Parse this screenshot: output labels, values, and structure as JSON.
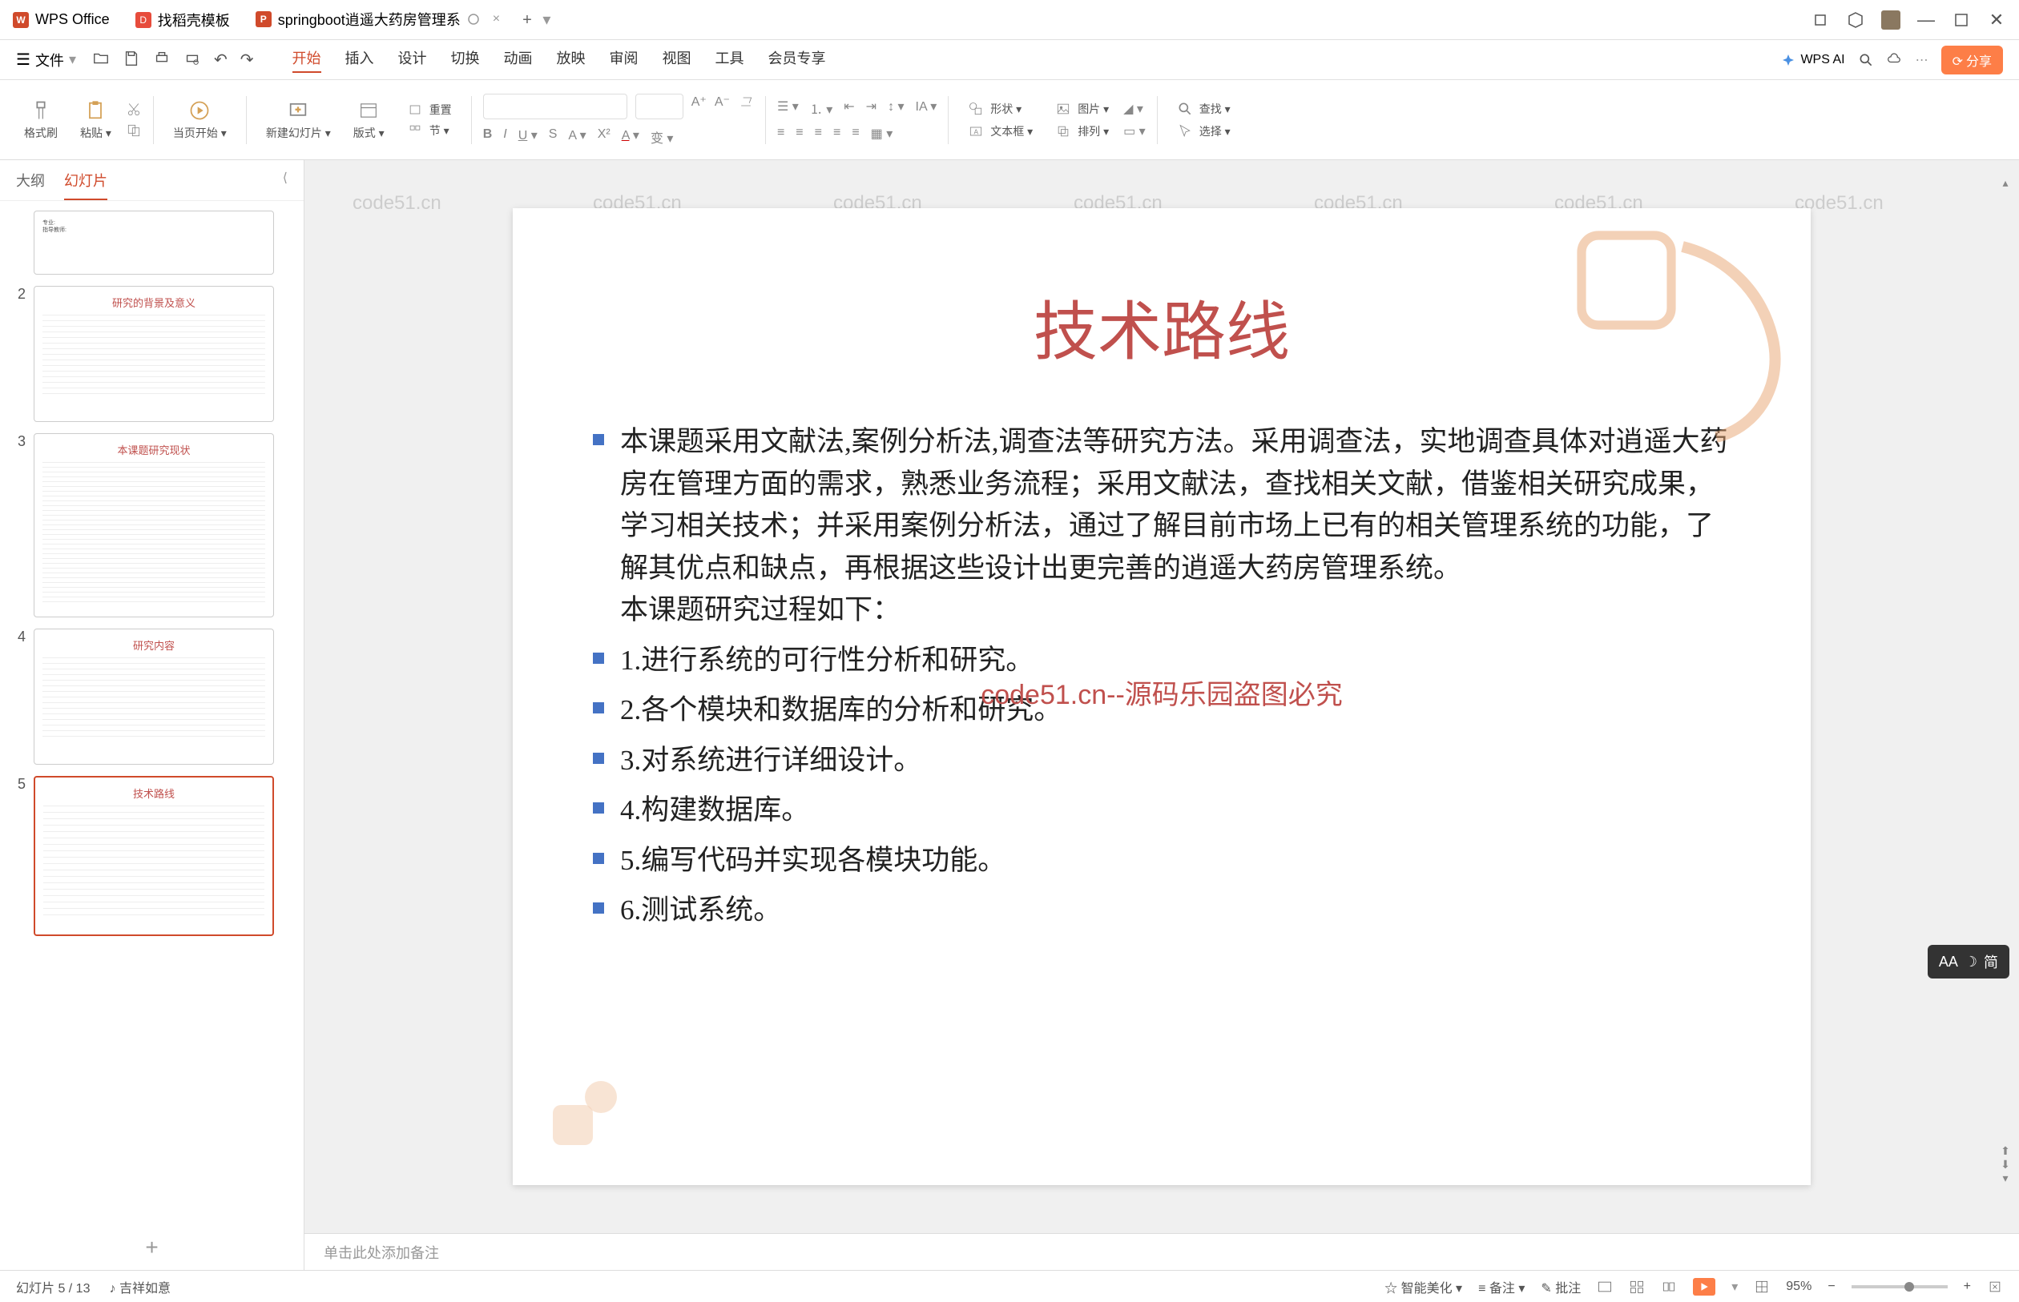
{
  "titlebar": {
    "wps_office": "WPS Office",
    "doke": "找稻壳模板",
    "active_tab": "springboot逍遥大药房管理系",
    "add": "+"
  },
  "menubar": {
    "file": "文件",
    "tabs": {
      "start": "开始",
      "insert": "插入",
      "design": "设计",
      "transition": "切换",
      "animation": "动画",
      "slideshow": "放映",
      "review": "审阅",
      "view": "视图",
      "tools": "工具",
      "member": "会员专享"
    },
    "wps_ai": "WPS AI",
    "share": "分享"
  },
  "toolbar": {
    "format_brush": "格式刷",
    "paste": "粘贴",
    "from_current": "当页开始",
    "new_slide": "新建幻灯片",
    "layout": "版式",
    "section": "节",
    "reset": "重置",
    "shape": "形状",
    "picture": "图片",
    "textbox": "文本框",
    "arrange": "排列",
    "find": "查找",
    "select": "选择"
  },
  "sidebar": {
    "outline": "大纲",
    "slides": "幻灯片",
    "thumbs": [
      {
        "num": "",
        "title": "",
        "lines": [
          "专业:",
          "指导教师:"
        ]
      },
      {
        "num": "2",
        "title": "研究的背景及意义",
        "lines": [
          ""
        ]
      },
      {
        "num": "3",
        "title": "本课题研究现状",
        "lines": [
          ""
        ]
      },
      {
        "num": "4",
        "title": "研究内容",
        "lines": [
          ""
        ]
      },
      {
        "num": "5",
        "title": "技术路线",
        "lines": [
          ""
        ]
      }
    ]
  },
  "slide": {
    "title": "技术路线",
    "para1": "本课题采用文献法,案例分析法,调查法等研究方法。采用调查法，实地调查具体对逍遥大药房在管理方面的需求，熟悉业务流程；采用文献法，查找相关文献，借鉴相关研究成果，学习相关技术；并采用案例分析法，通过了解目前市场上已有的相关管理系统的功能，了解其优点和缺点，再根据这些设计出更完善的逍遥大药房管理系统。",
    "para2": "本课题研究过程如下：",
    "items": [
      "1.进行系统的可行性分析和研究。",
      "2.各个模块和数据库的分析和研究。",
      "3.对系统进行详细设计。",
      "4.构建数据库。",
      "5.编写代码并实现各模块功能。",
      "6.测试系统。"
    ]
  },
  "watermark": {
    "text": "code51.cn",
    "red": "code51.cn--源码乐园盗图必究"
  },
  "notes": {
    "placeholder": "单击此处添加备注"
  },
  "statusbar": {
    "slide_count": "幻灯片 5 / 13",
    "theme": "吉祥如意",
    "beautify": "智能美化",
    "notes": "备注",
    "comments": "批注",
    "zoom": "95%"
  },
  "ime": {
    "text": "简"
  }
}
